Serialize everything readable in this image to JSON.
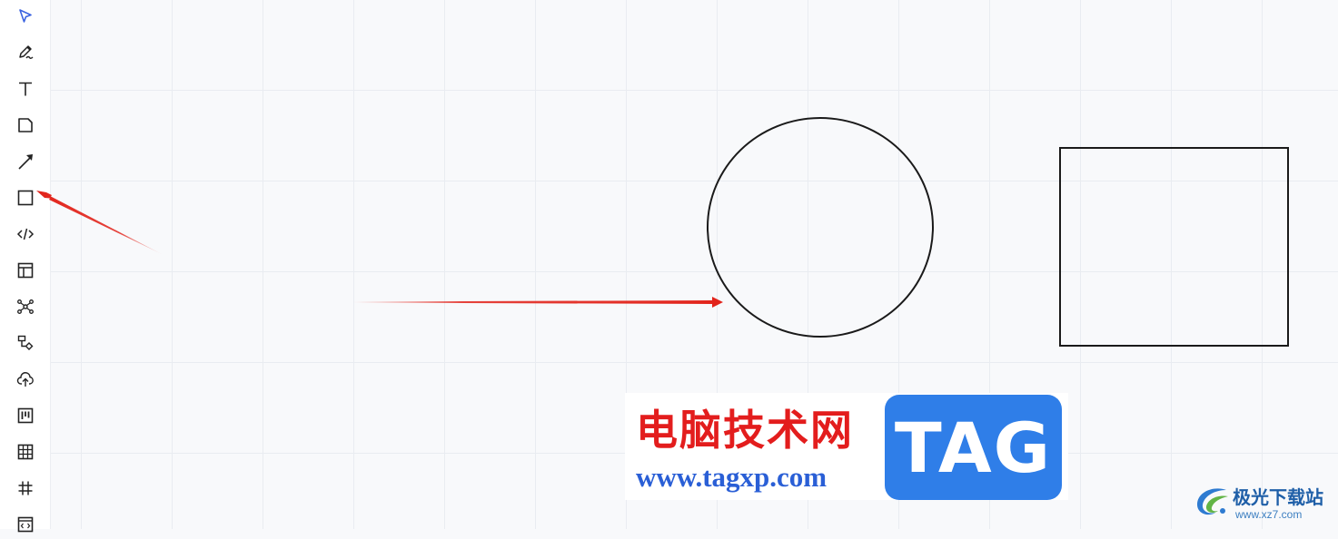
{
  "toolbar": {
    "tools": [
      {
        "id": "select",
        "icon": "pointer-icon"
      },
      {
        "id": "pen",
        "icon": "pen-icon"
      },
      {
        "id": "text",
        "icon": "text-icon"
      },
      {
        "id": "sticky-note",
        "icon": "sticky-note-icon"
      },
      {
        "id": "arrow",
        "icon": "arrow-icon"
      },
      {
        "id": "rectangle",
        "icon": "rectangle-icon"
      },
      {
        "id": "code",
        "icon": "code-icon"
      },
      {
        "id": "layout",
        "icon": "layout-icon"
      },
      {
        "id": "mindmap",
        "icon": "mindmap-icon"
      },
      {
        "id": "flowchart",
        "icon": "flowchart-icon"
      },
      {
        "id": "upload",
        "icon": "cloud-upload-icon"
      },
      {
        "id": "kanban",
        "icon": "kanban-icon"
      },
      {
        "id": "table",
        "icon": "table-icon"
      },
      {
        "id": "frame",
        "icon": "hash-icon"
      },
      {
        "id": "embed",
        "icon": "embed-icon"
      }
    ]
  },
  "colors": {
    "canvas_bg": "#f8f9fb",
    "grid": "#e9ecf1",
    "annotation_arrow": "#e2231a",
    "shape_stroke": "#1a1a1a"
  },
  "watermark": {
    "title": "电脑技术网",
    "url": "www.tagxp.com",
    "badge": "TAG"
  },
  "brand": {
    "name": "极光下载站",
    "url": "www.xz7.com"
  }
}
